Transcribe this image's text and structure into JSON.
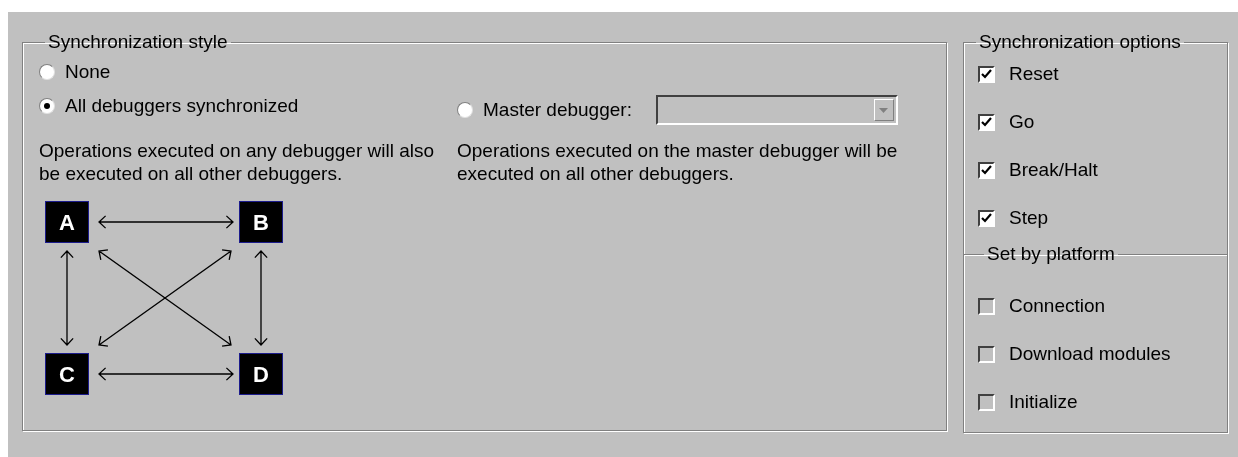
{
  "style_group": {
    "title": "Synchronization style",
    "modes": [
      {
        "label": "None",
        "selected": false
      },
      {
        "label": "All debuggers synchronized",
        "selected": true
      },
      {
        "label": "Master debugger:",
        "selected": false
      }
    ],
    "master_dropdown": {
      "disabled": true
    },
    "descriptions": [
      "Operations executed on any debugger will also be executed on all other debuggers.",
      "Operations executed on the master debugger will be executed on all other debuggers."
    ],
    "diagram": {
      "nodes": [
        "A",
        "B",
        "C",
        "D"
      ]
    }
  },
  "options_group": {
    "title": "Synchronization options",
    "options": [
      {
        "label": "Reset",
        "checked": true,
        "disabled": false
      },
      {
        "label": "Go",
        "checked": true,
        "disabled": false
      },
      {
        "label": "Break/Halt",
        "checked": true,
        "disabled": false
      },
      {
        "label": "Step",
        "checked": true,
        "disabled": false
      }
    ]
  },
  "platform_group": {
    "title": "Set by platform",
    "options": [
      {
        "label": "Connection",
        "checked": false,
        "disabled": true
      },
      {
        "label": "Download modules",
        "checked": false,
        "disabled": true
      },
      {
        "label": "Initialize",
        "checked": false,
        "disabled": true
      }
    ]
  }
}
